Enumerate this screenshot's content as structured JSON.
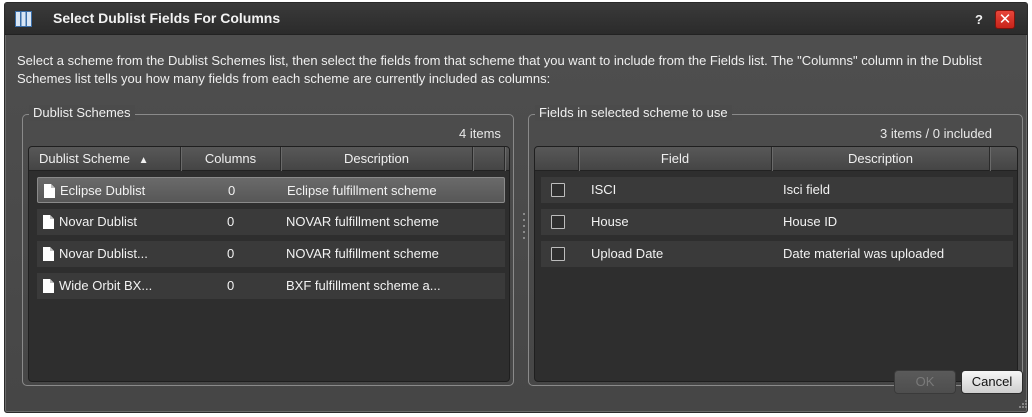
{
  "window": {
    "title": "Select Dublist Fields For Columns",
    "help_label": "?",
    "close_label": "✕"
  },
  "instructions": "Select a scheme from the Dublist Schemes list, then select the fields from that scheme that you want to include from the Fields list. The \"Columns\" column in the Dublist Schemes list tells you how many fields from each scheme are currently included as columns:",
  "schemes": {
    "group_label": "Dublist Schemes",
    "count": "4 items",
    "headers": {
      "scheme": "Dublist Scheme",
      "sort_indicator": "▲",
      "columns": "Columns",
      "description": "Description"
    },
    "rows": [
      {
        "name": "Eclipse Dublist",
        "columns": "0",
        "description": "Eclipse fulfillment scheme",
        "selected": true
      },
      {
        "name": "Novar Dublist",
        "columns": "0",
        "description": "NOVAR fulfillment scheme",
        "selected": false
      },
      {
        "name": "Novar Dublist...",
        "columns": "0",
        "description": "NOVAR fulfillment scheme",
        "selected": false
      },
      {
        "name": "Wide Orbit BX...",
        "columns": "0",
        "description": "BXF fulfillment scheme a...",
        "selected": false
      }
    ]
  },
  "fields": {
    "group_label": "Fields in selected scheme to use",
    "count": "3 items / 0 included",
    "headers": {
      "field": "Field",
      "description": "Description"
    },
    "rows": [
      {
        "field": "ISCI",
        "description": "Isci field",
        "checked": false
      },
      {
        "field": "House",
        "description": "House ID",
        "checked": false
      },
      {
        "field": "Upload Date",
        "description": "Date material was uploaded",
        "checked": false
      }
    ]
  },
  "buttons": {
    "ok": "OK",
    "cancel": "Cancel"
  },
  "icons": {
    "app": "columns-icon",
    "doc": "document-icon",
    "help": "help-icon",
    "close": "close-icon",
    "grip": "resize-grip-icon"
  }
}
